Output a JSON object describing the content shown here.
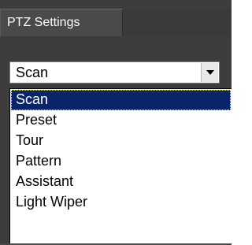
{
  "panel": {
    "tab_title": "PTZ Settings"
  },
  "mode_select": {
    "value": "Scan",
    "options": [
      "Scan",
      "Preset",
      "Tour",
      "Pattern",
      "Assistant",
      "Light Wiper"
    ],
    "selected_index": 0,
    "arrow_icon": "chevron-down-icon"
  },
  "colors": {
    "panel_background": "#3d3d3d",
    "selection_highlight": "#0a246a",
    "selection_text": "#ffffff"
  }
}
